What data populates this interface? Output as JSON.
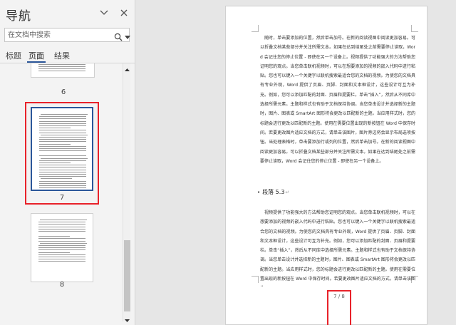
{
  "nav": {
    "title": "导航",
    "search_placeholder": "在文档中搜索",
    "tabs": [
      {
        "label": "标题",
        "selected": false
      },
      {
        "label": "页面",
        "selected": true
      },
      {
        "label": "结果",
        "selected": false
      }
    ],
    "pages": [
      {
        "number": "6"
      },
      {
        "number": "7",
        "selected": true
      },
      {
        "number": "8"
      }
    ]
  },
  "doc": {
    "para1": "随时，单击要添加的位置，然后单击加号。在新的阅读视图中阅读更加容易。可以折叠文档某些部分并关注所需文本。如果在达到结尾处之前需要停止读取，Word 会记住您的停止位置 - 即使在另一个设备上。视频提供了功能强大的方法帮助您证明您的观点。当您单击联机视频时，可以在想要添加的视频的嵌入代码中进行粘贴。您也可以键入一个关键字以联机搜索最适合您的文档的视频。为使您的文档具有专业外观，Word 提供了页眉、页脚、封面和文本框设计，这些设计可互为补充。例如，您可以添加匹配的封面、页眉和提要栏。单击“插入”，然后从不同库中选择所需元素。主题和样式也有助于文档保持协调。当您单击设计并选择新的主题时，图片、图表或 SmartArt 图形将会更改以匹配新的主题。当应用样式时，您的标题会进行更改以匹配新的主题。使用在需要位置出现的新按钮在 Word 中保存时间。若要更改图片适应文档的方式，请单击该图片，图片旁边将会显示布局选项按钮。当处理表格时，单击要添加行或列的位置，然后单击加号。在新的阅读视图中阅读更加容易。可以折叠文档某些部分并关注所需文本。如果在达到结尾处之前需要停止读取，Word 会记住您的停止位置 - 即使在另一个设备上。",
    "heading": "段落 5.3",
    "para2": "视频提供了功能强大的方法帮助您证明您的观点。当您单击联机视频时，可以在想要添加的视频的嵌入代码中进行粘贴。您也可以键入一个关键字以联机搜索最适合您的文档的视频。为使您的文档具有专业外观，Word 提供了页眉、页脚、封面和文本框设计，这些设计可互为补充。例如，您可以添加匹配的封面、页眉和提要栏。单击“插入”，然后从不同库中选择所需元素。主题和样式也有助于文档保持协调。当您单击设计并选择新的主题时，图片、图表或 SmartArt 图形将会更改以匹配新的主题。当应用样式时，您的标题会进行更改以匹配新的主题。使用在需要位置出现的新按钮在 Word 中保存时间。若要更改图片适应文档的方式，请单击该图片。",
    "page_number": "7 / 8"
  },
  "colors": {
    "selection_highlight": "#e8222a",
    "accent": "#2b579a"
  },
  "icons": [
    "chevron-down-icon",
    "close-icon",
    "search-icon",
    "dropdown-arrow-icon",
    "scroll-up-icon",
    "scroll-down-icon"
  ]
}
